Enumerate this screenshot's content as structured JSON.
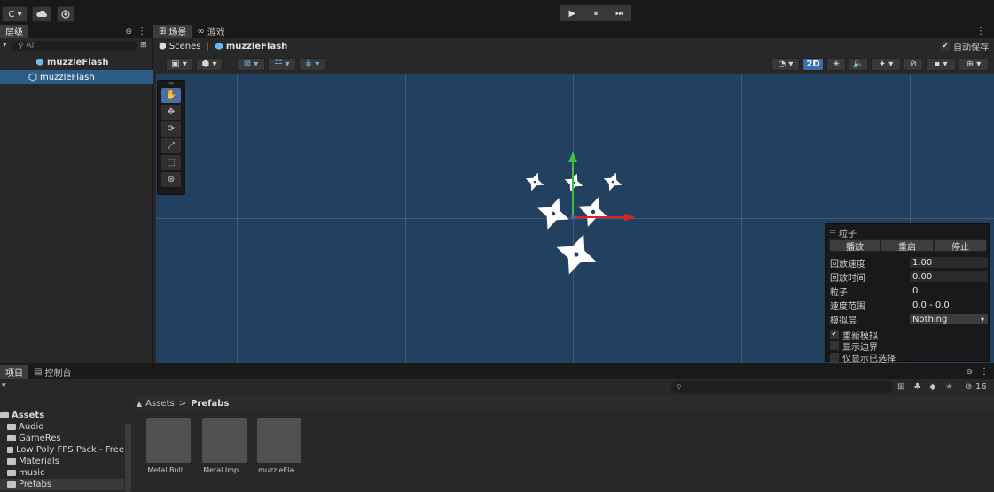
{
  "toolbar": {
    "account_label": "C ▾",
    "cloud_icon": "cloud-icon",
    "collab_icon": "collab-icon",
    "play_glyph": "▶",
    "pause_glyph": "⏸",
    "step_glyph": "⏭"
  },
  "hierarchy": {
    "tab_label": "层级",
    "tab_lock": "🔒",
    "tab_more": "⋮",
    "search_placeholder": "All",
    "items": [
      {
        "label": "muzzleFlash"
      },
      {
        "label": "muzzleFlash"
      }
    ]
  },
  "scene": {
    "tabs": [
      {
        "label": "场景"
      },
      {
        "label": "游戏"
      }
    ],
    "breadcrumb_root": "Scenes",
    "breadcrumb_sep": "|",
    "breadcrumb_item": "muzzleFlash",
    "auto_save_label": "自动保存",
    "toggle_2d": "2D",
    "tools": [
      "✋",
      "✥",
      "⟳",
      "⤢",
      "⬚",
      "⊛",
      "⛶"
    ]
  },
  "particle": {
    "title": "粒子",
    "play_label": "播放",
    "restart_label": "重启",
    "stop_label": "停止",
    "rows": [
      {
        "label": "回放速度",
        "value": "1.00"
      },
      {
        "label": "回放时间",
        "value": "0.00"
      },
      {
        "label": "粒子",
        "value": "0"
      },
      {
        "label": "速度范围",
        "value": "0.0 - 0.0"
      },
      {
        "label": "模拟层",
        "value": "Nothing"
      }
    ],
    "checks": [
      {
        "label": "重新模拟",
        "checked": true
      },
      {
        "label": "显示边界",
        "checked": false
      },
      {
        "label": "仅显示已选择",
        "checked": false
      }
    ]
  },
  "project": {
    "tabs": [
      {
        "label": "项目"
      },
      {
        "label": "控制台"
      }
    ],
    "hidden_count": "16",
    "breadcrumb_root": "Assets",
    "breadcrumb_sep": ">",
    "breadcrumb_current": "Prefabs",
    "tree": [
      {
        "label": "Assets"
      },
      {
        "label": "Audio"
      },
      {
        "label": "GameRes"
      },
      {
        "label": "Low Poly FPS Pack - Free"
      },
      {
        "label": "Materials"
      },
      {
        "label": "music"
      },
      {
        "label": "Prefabs"
      }
    ],
    "assets": [
      {
        "label": "Metal Bull..."
      },
      {
        "label": "Metal Imp..."
      },
      {
        "label": "muzzleFla..."
      }
    ]
  },
  "colors": {
    "scene_bg": "#22405f",
    "selection": "#2c5d87",
    "axis_y": "#40c040",
    "axis_x": "#e02020",
    "accent_2d": "#3d6ea8"
  }
}
